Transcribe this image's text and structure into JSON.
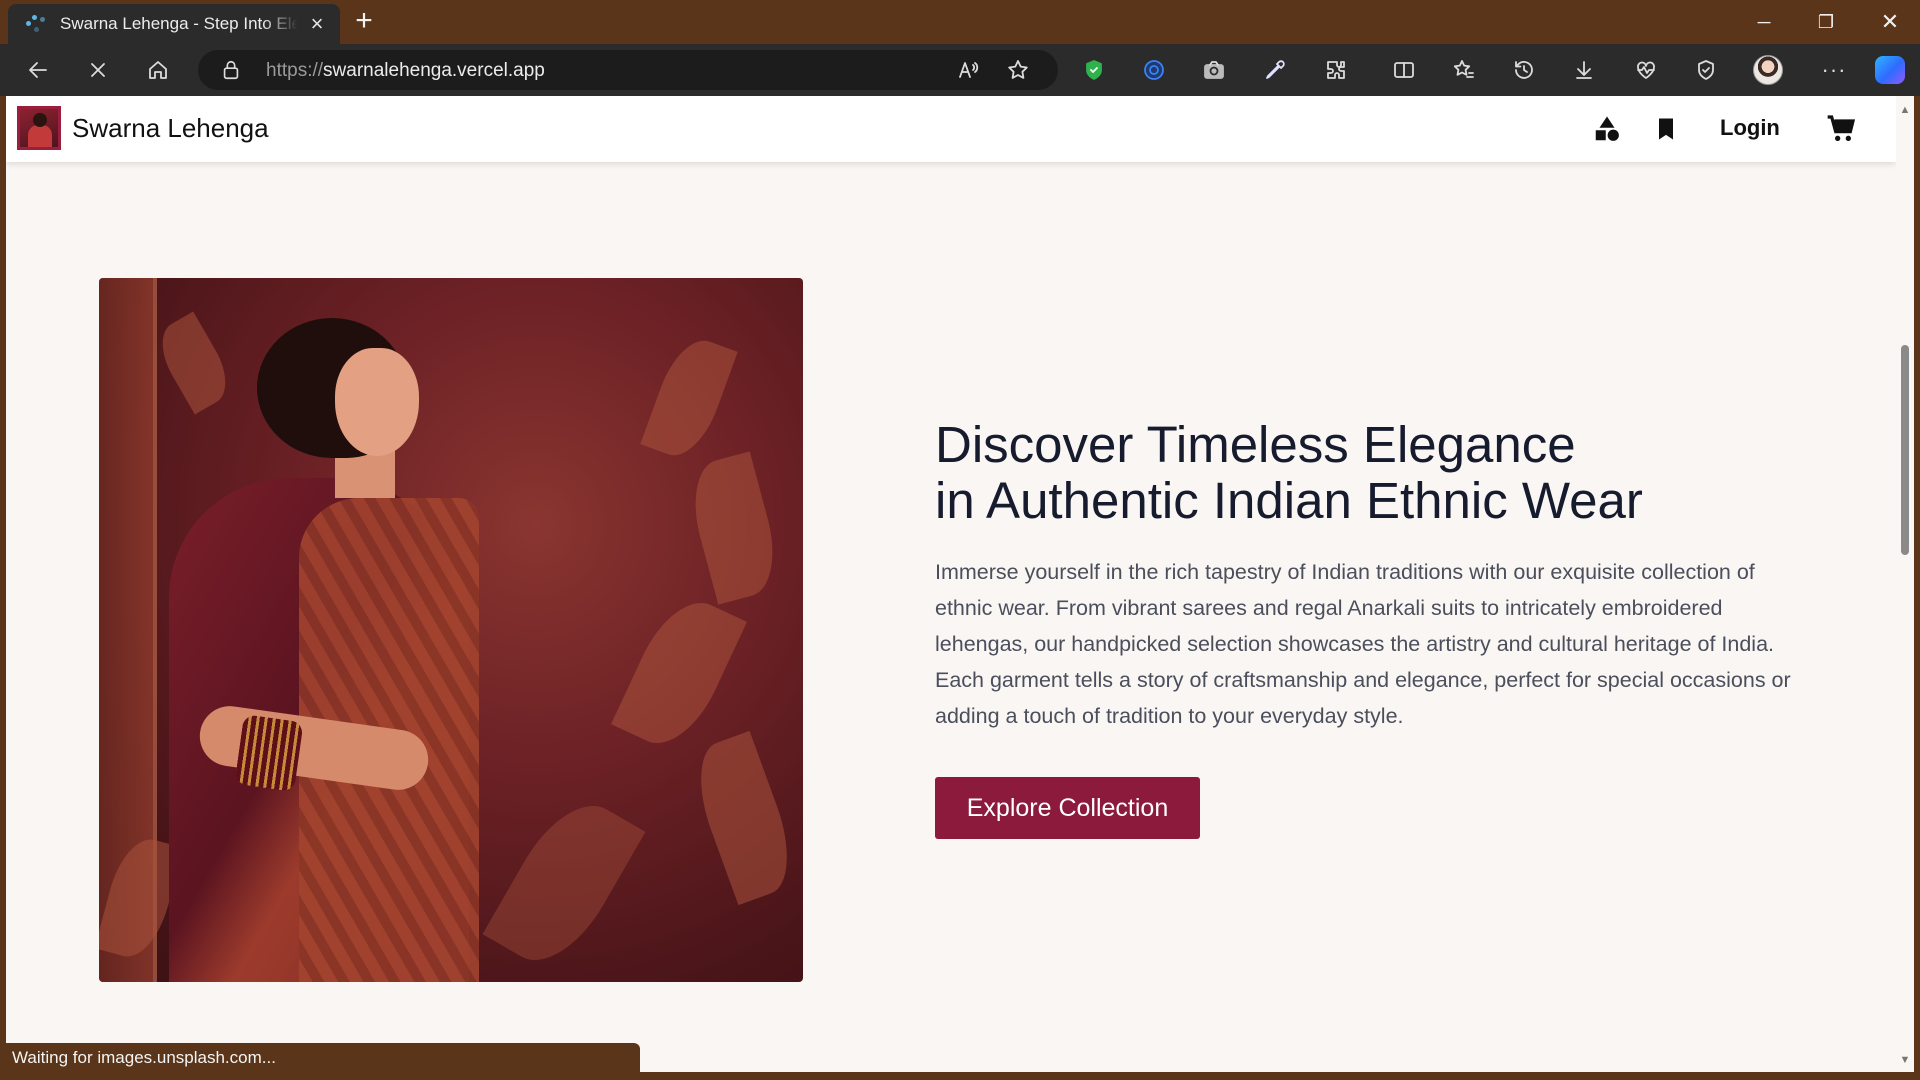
{
  "browser": {
    "tab": {
      "title": "Swarna Lehenga - Step Into Elegance"
    },
    "address": {
      "scheme": "https://",
      "host": "swarnalehenga.vercel.app"
    },
    "status_text": "Waiting for images.unsplash.com...",
    "loading": true,
    "extension_icons": [
      "shield-extension-icon",
      "circle-extension-icon",
      "camera-extension-icon",
      "eyedropper-extension-icon",
      "puzzle-extensions-icon"
    ],
    "toolbar_icons": [
      "split-screen-icon",
      "favorites-icon",
      "history-icon",
      "downloads-icon",
      "performance-icon",
      "browser-essentials-icon",
      "profile-avatar",
      "more-menu-icon",
      "copilot-icon"
    ],
    "accent_color": "#5a3519"
  },
  "site": {
    "brand": "Swarna Lehenga",
    "nav": {
      "categories_icon": "shapes-icon",
      "wishlist_icon": "bookmark-icon",
      "login_label": "Login",
      "cart_icon": "cart-icon"
    },
    "hero": {
      "title_line1": "Discover Timeless Elegance",
      "title_line2": "in Authentic Indian Ethnic Wear",
      "description": "Immerse yourself in the rich tapestry of Indian traditions with our exquisite collection of ethnic wear. From vibrant sarees and regal Anarkali suits to intricately embroidered lehengas, our handpicked selection showcases the artistry and cultural heritage of India. Each garment tells a story of craftsmanship and elegance, perfect for special occasions or adding a touch of tradition to your everyday style.",
      "cta_label": "Explore Collection",
      "cta_color": "#8c1a3c"
    }
  }
}
